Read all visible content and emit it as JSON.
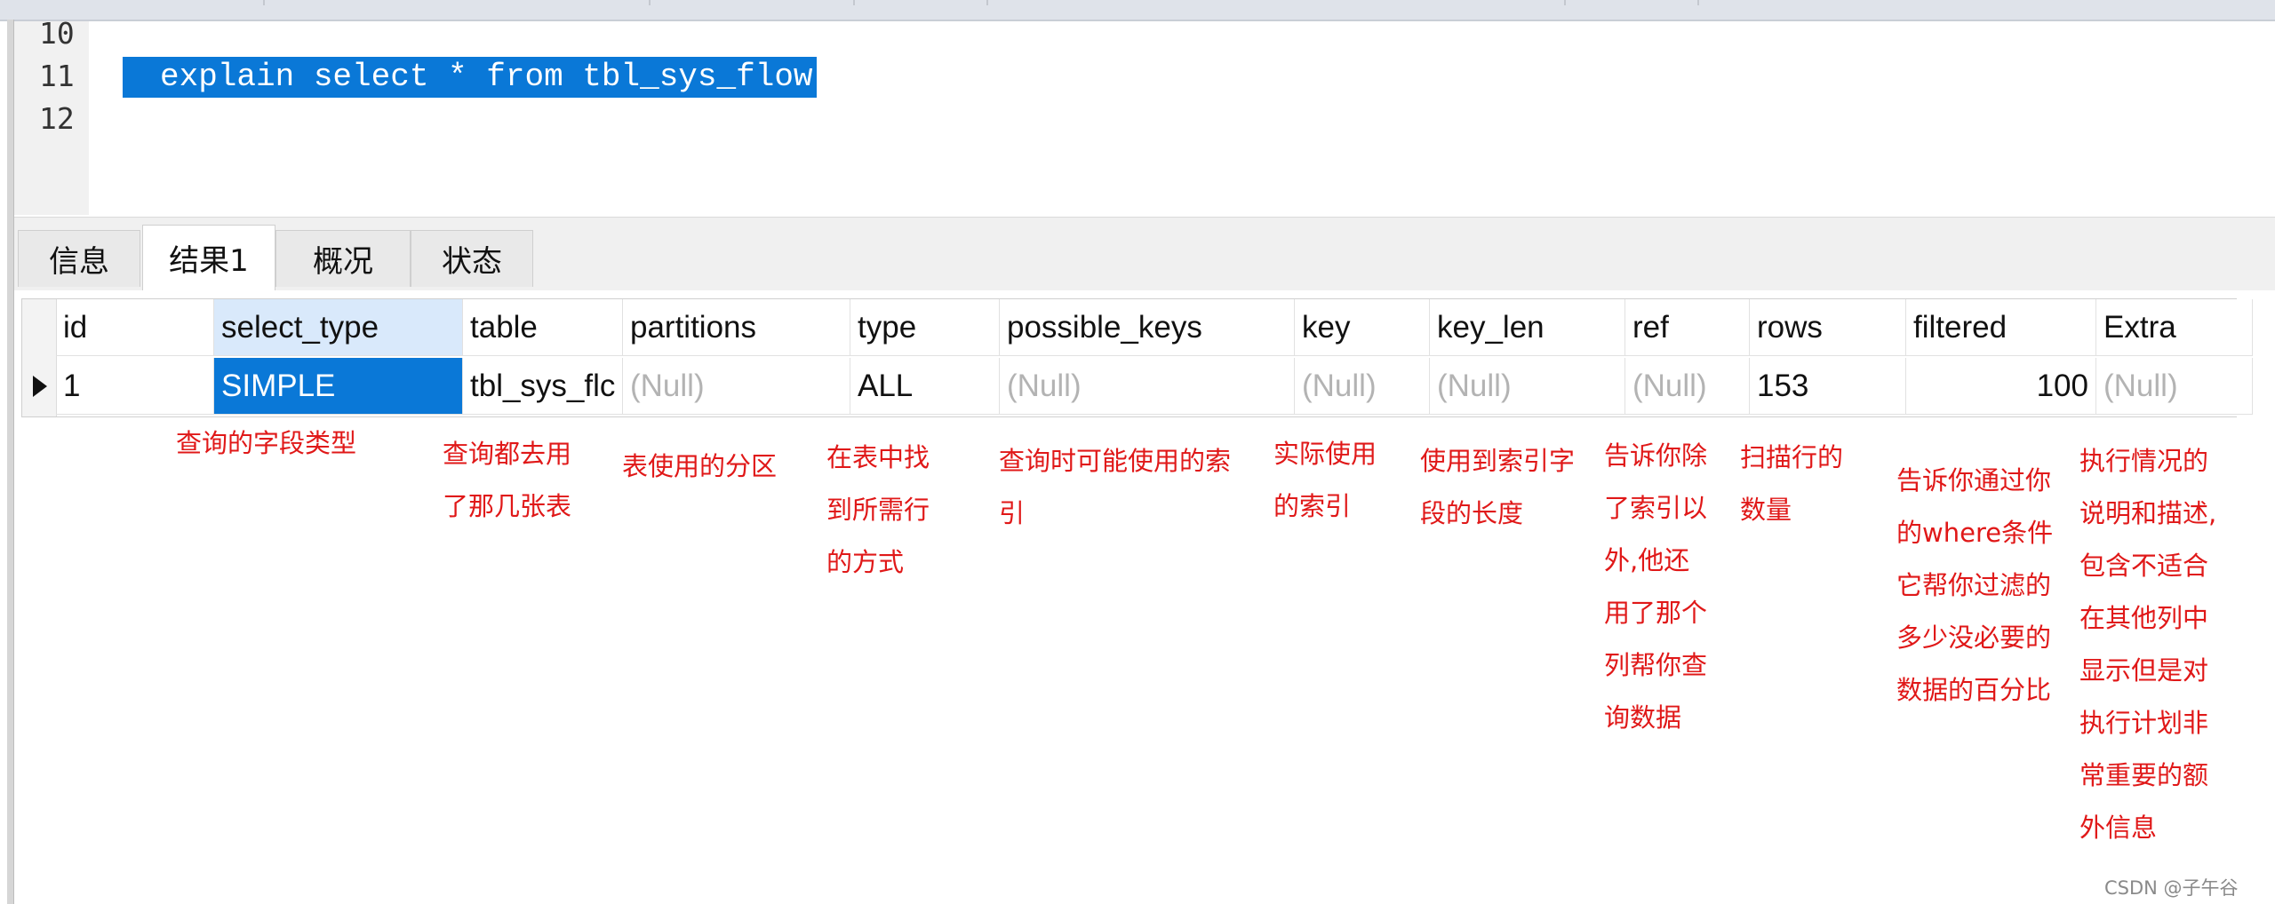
{
  "editor": {
    "line_numbers": [
      "10",
      "11",
      "12"
    ],
    "code": "explain select * from tbl_sys_flow"
  },
  "tabs": [
    {
      "label": "信息"
    },
    {
      "label": "结果1"
    },
    {
      "label": "概况"
    },
    {
      "label": "状态"
    }
  ],
  "grid": {
    "columns": [
      "id",
      "select_type",
      "table",
      "partitions",
      "type",
      "possible_keys",
      "key",
      "key_len",
      "ref",
      "rows",
      "filtered",
      "Extra"
    ],
    "row": [
      "1",
      "SIMPLE",
      "tbl_sys_flc",
      "(Null)",
      "ALL",
      "(Null)",
      "(Null)",
      "(Null)",
      "(Null)",
      "153",
      "100",
      "(Null)"
    ]
  },
  "annotations": {
    "select_type": "查询的字段类型",
    "table": "查询都去用\n了那几张表",
    "partitions": "表使用的分区",
    "type": "在表中找\n到所需行\n的方式",
    "possible_keys": "查询时可能使用的索\n引",
    "key": "实际使用\n的索引",
    "key_len": "使用到索引字\n段的长度",
    "ref": "告诉你除\n了索引以\n外,他还\n用了那个\n列帮你查\n询数据",
    "rows": "扫描行的\n数量",
    "filtered": "告诉你通过你\n的where条件\n它帮你过滤的\n多少没必要的\n数据的百分比",
    "Extra": "执行情况的\n说明和描述,\n包含不适合\n在其他列中\n显示但是对\n执行计划非\n常重要的额\n外信息"
  },
  "watermark": "CSDN @子午谷",
  "colors": {
    "selection": "#0a78d7",
    "annotation": "#e01818",
    "null_text": "#b3b3b3"
  }
}
